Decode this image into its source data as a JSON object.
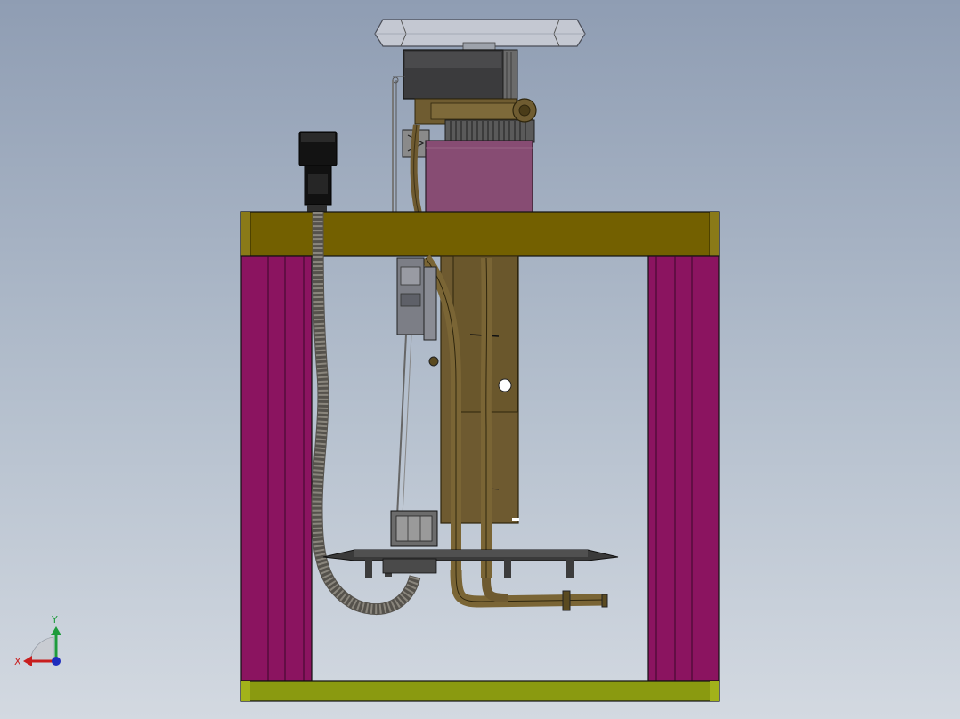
{
  "viewport": {
    "background_top": "#8f9db3",
    "background_bottom": "#d3d9e1"
  },
  "model": {
    "frame_top_bar_color": "#736000",
    "frame_bottom_bar_color": "#8a9a10",
    "frame_post_color": "#8b1460",
    "pump_housing_color": "#e0e0e0",
    "pipe_color": "#6e5a30",
    "block_color": "#874c73",
    "motor_color": "#3c3c3c",
    "connector_color": "#111111"
  },
  "triad": {
    "x_label": "X",
    "y_label": "Y",
    "x_color": "#c81e1e",
    "y_color": "#1e9b3c",
    "z_color": "#1e2dbe"
  }
}
